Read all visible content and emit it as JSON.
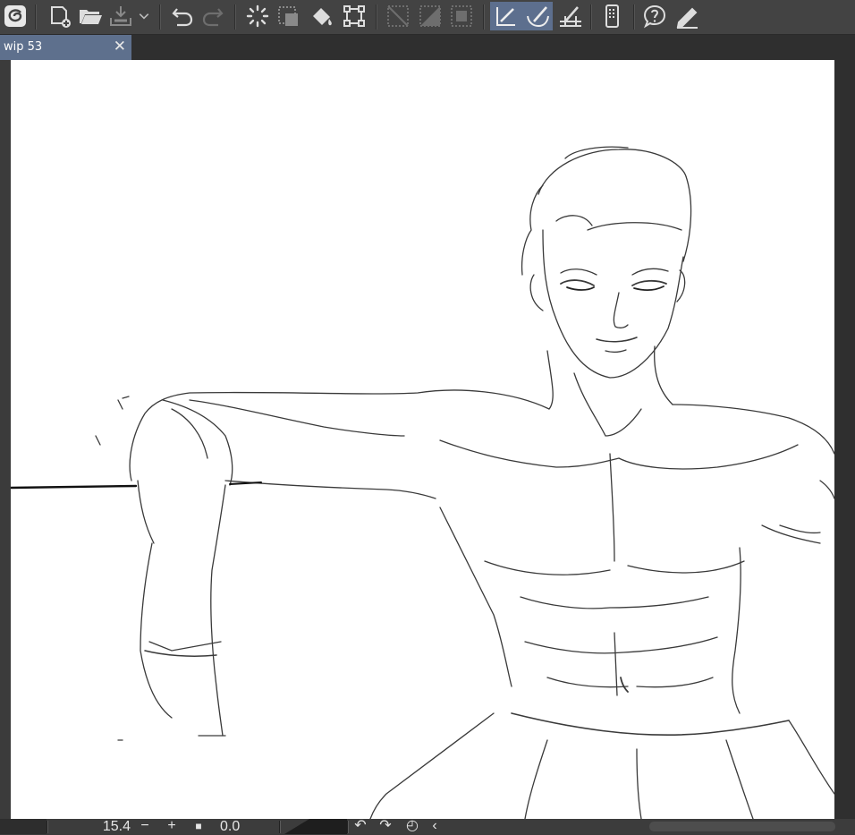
{
  "toolbar": {
    "buttons": [
      {
        "name": "app-menu",
        "icon": "app-logo-icon"
      },
      {
        "name": "new-canvas",
        "icon": "new-file-icon"
      },
      {
        "name": "open-file",
        "icon": "folder-open-icon"
      },
      {
        "name": "save-export",
        "icon": "export-icon"
      },
      {
        "name": "undo",
        "icon": "undo-icon"
      },
      {
        "name": "redo",
        "icon": "redo-icon"
      },
      {
        "name": "loading",
        "icon": "spinner-icon"
      },
      {
        "name": "selection",
        "icon": "selection-icon"
      },
      {
        "name": "fill",
        "icon": "fill-icon"
      },
      {
        "name": "transform",
        "icon": "transform-icon"
      },
      {
        "name": "clear-selection",
        "icon": "clear-icon"
      },
      {
        "name": "invert-selection",
        "icon": "invert-icon"
      },
      {
        "name": "show-selection",
        "icon": "selection-frame-icon"
      },
      {
        "name": "snap-ruler",
        "icon": "ruler-snap-icon",
        "active": true
      },
      {
        "name": "snap-special-ruler",
        "icon": "special-ruler-snap-icon",
        "active": true
      },
      {
        "name": "snap-grid",
        "icon": "grid-snap-icon"
      },
      {
        "name": "companion-mode",
        "icon": "smartphone-icon"
      },
      {
        "name": "help",
        "icon": "help-icon"
      },
      {
        "name": "pen-settings",
        "icon": "pen-icon"
      }
    ]
  },
  "document": {
    "tab_title": "wip 53",
    "close_glyph": "✕"
  },
  "statusbar": {
    "zoom": "15.4",
    "zoom_out": "−",
    "zoom_in": "+",
    "fit": "■",
    "angle": "0.0",
    "rotate_left": "↶",
    "rotate_right": "↷",
    "reset_rotation": "◴",
    "collapse": "‹"
  },
  "colors": {
    "toolbar_bg": "#434343",
    "tab_active": "#5e708d",
    "active_tool": "#5d6f8e",
    "canvas_bg": "#ffffff",
    "workspace_bg": "#3b3b3b"
  }
}
